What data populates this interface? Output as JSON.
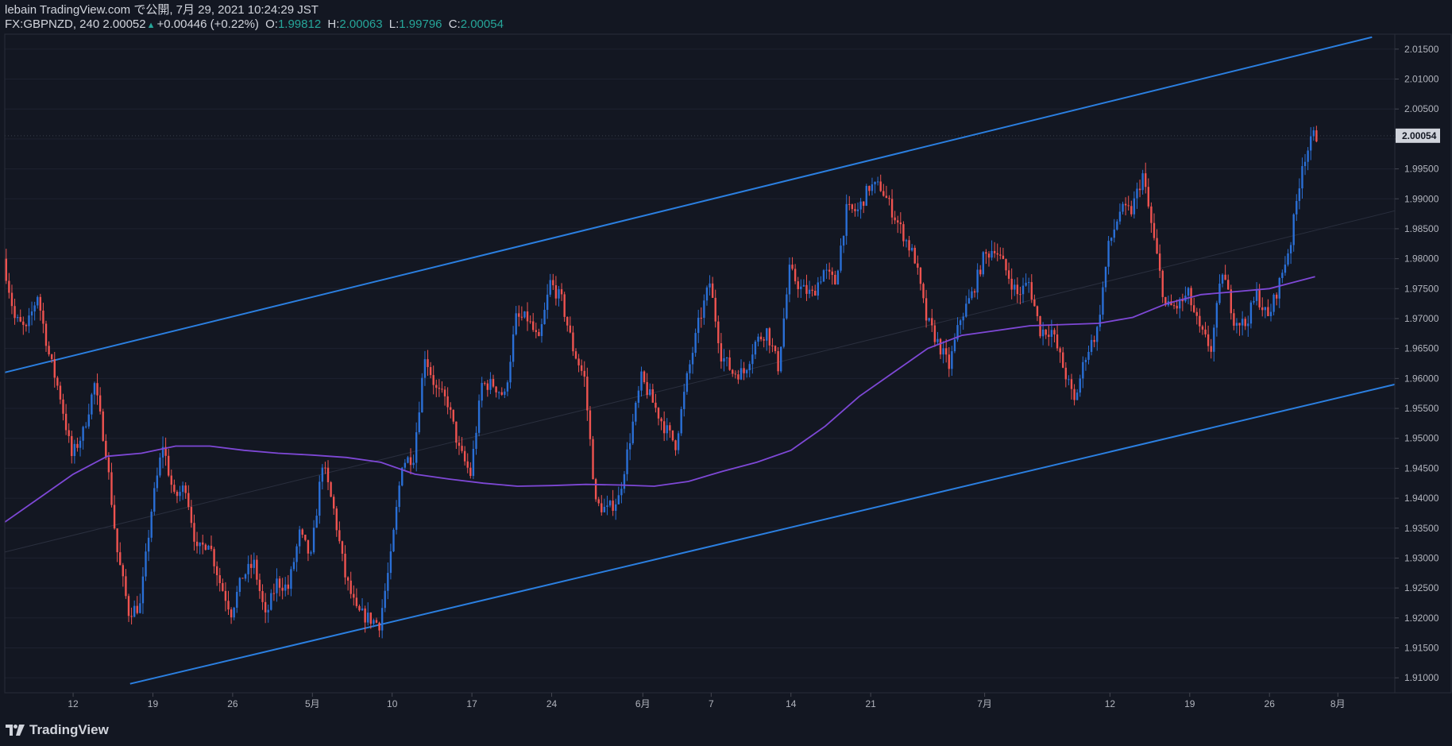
{
  "header": {
    "publisher_line": "lebain TradingView.com で公開, 7月 29, 2021 10:24:29 JST",
    "symbol": "FX:GBPNZD, 240",
    "last_price": "2.00052",
    "change": "+0.00446 (+0.22%)",
    "open_label": "O:",
    "open_value": "1.99812",
    "high_label": "H:",
    "high_value": "2.00063",
    "low_label": "L:",
    "low_value": "1.99796",
    "close_label": "C:",
    "close_value": "2.00054"
  },
  "brand": {
    "name": "TradingView",
    "icon": "tradingview-logo-icon"
  },
  "colors": {
    "background": "#131722",
    "up_candle": "#2a6fd6",
    "down_candle": "#ef5350",
    "channel_line": "#2b7fe0",
    "moving_average": "#7e48d6",
    "grid": "#1e2230",
    "axis_text": "#b2b5be",
    "price_label_bg": "#d1d4dc"
  },
  "chart_data": {
    "type": "candlestick",
    "symbol": "FX:GBPNZD",
    "timeframe": "240",
    "ylim": [
      1.9075,
      2.0175
    ],
    "y_ticks": [
      "2.01500",
      "2.01000",
      "2.00500",
      "2.00000",
      "1.99500",
      "1.99000",
      "1.98500",
      "1.98000",
      "1.97500",
      "1.97000",
      "1.96500",
      "1.96000",
      "1.95500",
      "1.95000",
      "1.94500",
      "1.94000",
      "1.93500",
      "1.93000",
      "1.92500",
      "1.92000",
      "1.91500",
      "1.91000"
    ],
    "current_price_label": "2.00054",
    "current_price": 2.00054,
    "x_range": [
      "2021-04-06",
      "2021-08-06"
    ],
    "x_ticks": [
      {
        "label": "12",
        "date": "2021-04-12"
      },
      {
        "label": "19",
        "date": "2021-04-19"
      },
      {
        "label": "26",
        "date": "2021-04-26"
      },
      {
        "label": "5月",
        "date": "2021-05-03"
      },
      {
        "label": "10",
        "date": "2021-05-10"
      },
      {
        "label": "17",
        "date": "2021-05-17"
      },
      {
        "label": "24",
        "date": "2021-05-24"
      },
      {
        "label": "6月",
        "date": "2021-06-01"
      },
      {
        "label": "7",
        "date": "2021-06-07"
      },
      {
        "label": "14",
        "date": "2021-06-14"
      },
      {
        "label": "21",
        "date": "2021-06-21"
      },
      {
        "label": "7月",
        "date": "2021-07-01"
      },
      {
        "label": "12",
        "date": "2021-07-12"
      },
      {
        "label": "19",
        "date": "2021-07-19"
      },
      {
        "label": "26",
        "date": "2021-07-26"
      },
      {
        "label": "8月",
        "date": "2021-08-01"
      }
    ],
    "price_path": [
      [
        "2021-04-06",
        1.98
      ],
      [
        "2021-04-07",
        1.97
      ],
      [
        "2021-04-08",
        1.968
      ],
      [
        "2021-04-09",
        1.974
      ],
      [
        "2021-04-10",
        1.964
      ],
      [
        "2021-04-11",
        1.957
      ],
      [
        "2021-04-12",
        1.947
      ],
      [
        "2021-04-13",
        1.951
      ],
      [
        "2021-04-14",
        1.959
      ],
      [
        "2021-04-15",
        1.948
      ],
      [
        "2021-04-16",
        1.931
      ],
      [
        "2021-04-17",
        1.921
      ],
      [
        "2021-04-18",
        1.922
      ],
      [
        "2021-04-19",
        1.938
      ],
      [
        "2021-04-20",
        1.949
      ],
      [
        "2021-04-21",
        1.94
      ],
      [
        "2021-04-22",
        1.942
      ],
      [
        "2021-04-23",
        1.931
      ],
      [
        "2021-04-24",
        1.933
      ],
      [
        "2021-04-25",
        1.926
      ],
      [
        "2021-04-26",
        1.921
      ],
      [
        "2021-04-27",
        1.927
      ],
      [
        "2021-04-28",
        1.929
      ],
      [
        "2021-04-29",
        1.92
      ],
      [
        "2021-04-30",
        1.926
      ],
      [
        "2021-05-01",
        1.925
      ],
      [
        "2021-05-02",
        1.934
      ],
      [
        "2021-05-03",
        1.93
      ],
      [
        "2021-05-04",
        1.946
      ],
      [
        "2021-05-05",
        1.938
      ],
      [
        "2021-05-06",
        1.927
      ],
      [
        "2021-05-07",
        1.921
      ],
      [
        "2021-05-08",
        1.92
      ],
      [
        "2021-05-09",
        1.919
      ],
      [
        "2021-05-10",
        1.93
      ],
      [
        "2021-05-11",
        1.946
      ],
      [
        "2021-05-12",
        1.947
      ],
      [
        "2021-05-13",
        1.964
      ],
      [
        "2021-05-14",
        1.958
      ],
      [
        "2021-05-15",
        1.956
      ],
      [
        "2021-05-16",
        1.948
      ],
      [
        "2021-05-17",
        1.944
      ],
      [
        "2021-05-18",
        1.959
      ],
      [
        "2021-05-19",
        1.959
      ],
      [
        "2021-05-20",
        1.957
      ],
      [
        "2021-05-21",
        1.97
      ],
      [
        "2021-05-22",
        1.97
      ],
      [
        "2021-05-23",
        1.966
      ],
      [
        "2021-05-24",
        1.976
      ],
      [
        "2021-05-25",
        1.973
      ],
      [
        "2021-05-26",
        1.965
      ],
      [
        "2021-05-27",
        1.96
      ],
      [
        "2021-05-28",
        1.939
      ],
      [
        "2021-05-29",
        1.938
      ],
      [
        "2021-05-30",
        1.94
      ],
      [
        "2021-05-31",
        1.95
      ],
      [
        "2021-06-01",
        1.96
      ],
      [
        "2021-06-02",
        1.956
      ],
      [
        "2021-06-03",
        1.952
      ],
      [
        "2021-06-04",
        1.949
      ],
      [
        "2021-06-05",
        1.96
      ],
      [
        "2021-06-06",
        1.969
      ],
      [
        "2021-06-07",
        1.976
      ],
      [
        "2021-06-08",
        1.964
      ],
      [
        "2021-06-09",
        1.961
      ],
      [
        "2021-06-10",
        1.961
      ],
      [
        "2021-06-11",
        1.966
      ],
      [
        "2021-06-12",
        1.968
      ],
      [
        "2021-06-13",
        1.962
      ],
      [
        "2021-06-14",
        1.978
      ],
      [
        "2021-06-15",
        1.975
      ],
      [
        "2021-06-16",
        1.974
      ],
      [
        "2021-06-17",
        1.978
      ],
      [
        "2021-06-18",
        1.976
      ],
      [
        "2021-06-19",
        1.988
      ],
      [
        "2021-06-20",
        1.988
      ],
      [
        "2021-06-21",
        1.992
      ],
      [
        "2021-06-22",
        1.992
      ],
      [
        "2021-06-23",
        1.988
      ],
      [
        "2021-06-24",
        1.984
      ],
      [
        "2021-06-25",
        1.98
      ],
      [
        "2021-06-26",
        1.97
      ],
      [
        "2021-06-27",
        1.966
      ],
      [
        "2021-06-28",
        1.962
      ],
      [
        "2021-06-29",
        1.97
      ],
      [
        "2021-06-30",
        1.974
      ],
      [
        "2021-07-01",
        1.98
      ],
      [
        "2021-07-02",
        1.982
      ],
      [
        "2021-07-03",
        1.978
      ],
      [
        "2021-07-04",
        1.974
      ],
      [
        "2021-07-05",
        1.976
      ],
      [
        "2021-07-06",
        1.968
      ],
      [
        "2021-07-07",
        1.968
      ],
      [
        "2021-07-08",
        1.962
      ],
      [
        "2021-07-09",
        1.956
      ],
      [
        "2021-07-10",
        1.964
      ],
      [
        "2021-07-11",
        1.968
      ],
      [
        "2021-07-12",
        1.982
      ],
      [
        "2021-07-13",
        1.988
      ],
      [
        "2021-07-14",
        1.988
      ],
      [
        "2021-07-15",
        1.994
      ],
      [
        "2021-07-16",
        1.983
      ],
      [
        "2021-07-17",
        1.972
      ],
      [
        "2021-07-18",
        1.972
      ],
      [
        "2021-07-19",
        1.974
      ],
      [
        "2021-07-20",
        1.968
      ],
      [
        "2021-07-21",
        1.965
      ],
      [
        "2021-07-22",
        1.978
      ],
      [
        "2021-07-23",
        1.97
      ],
      [
        "2021-07-24",
        1.969
      ],
      [
        "2021-07-25",
        1.974
      ],
      [
        "2021-07-26",
        1.97
      ],
      [
        "2021-07-27",
        1.976
      ],
      [
        "2021-07-28",
        1.983
      ],
      [
        "2021-07-29",
        1.996
      ],
      [
        "2021-07-30",
        2.0005
      ]
    ],
    "moving_average": [
      [
        "2021-04-06",
        1.936
      ],
      [
        "2021-04-09",
        1.94
      ],
      [
        "2021-04-12",
        1.944
      ],
      [
        "2021-04-15",
        1.947
      ],
      [
        "2021-04-18",
        1.9475
      ],
      [
        "2021-04-21",
        1.9487
      ],
      [
        "2021-04-24",
        1.9487
      ],
      [
        "2021-04-27",
        1.948
      ],
      [
        "2021-04-30",
        1.9475
      ],
      [
        "2021-05-03",
        1.9472
      ],
      [
        "2021-05-06",
        1.9468
      ],
      [
        "2021-05-09",
        1.946
      ],
      [
        "2021-05-12",
        1.944
      ],
      [
        "2021-05-15",
        1.9432
      ],
      [
        "2021-05-18",
        1.9425
      ],
      [
        "2021-05-21",
        1.942
      ],
      [
        "2021-05-24",
        1.9421
      ],
      [
        "2021-05-27",
        1.9423
      ],
      [
        "2021-05-30",
        1.9422
      ],
      [
        "2021-06-02",
        1.942
      ],
      [
        "2021-06-05",
        1.9428
      ],
      [
        "2021-06-08",
        1.9445
      ],
      [
        "2021-06-11",
        1.946
      ],
      [
        "2021-06-14",
        1.948
      ],
      [
        "2021-06-17",
        1.952
      ],
      [
        "2021-06-20",
        1.957
      ],
      [
        "2021-06-23",
        1.961
      ],
      [
        "2021-06-26",
        1.965
      ],
      [
        "2021-06-29",
        1.9672
      ],
      [
        "2021-07-02",
        1.968
      ],
      [
        "2021-07-05",
        1.9688
      ],
      [
        "2021-07-08",
        1.969
      ],
      [
        "2021-07-11",
        1.9692
      ],
      [
        "2021-07-14",
        1.9702
      ],
      [
        "2021-07-17",
        1.9725
      ],
      [
        "2021-07-20",
        1.974
      ],
      [
        "2021-07-23",
        1.9745
      ],
      [
        "2021-07-26",
        1.975
      ],
      [
        "2021-07-28",
        1.976
      ],
      [
        "2021-07-30",
        1.977
      ]
    ],
    "channel_upper": [
      [
        "2021-04-06",
        1.961
      ],
      [
        "2021-08-04",
        2.017
      ]
    ],
    "channel_lower": [
      [
        "2021-04-17",
        1.909
      ],
      [
        "2021-08-06",
        1.959
      ]
    ],
    "channel_mid": [
      [
        "2021-04-06",
        1.931
      ],
      [
        "2021-08-06",
        1.988
      ]
    ]
  }
}
